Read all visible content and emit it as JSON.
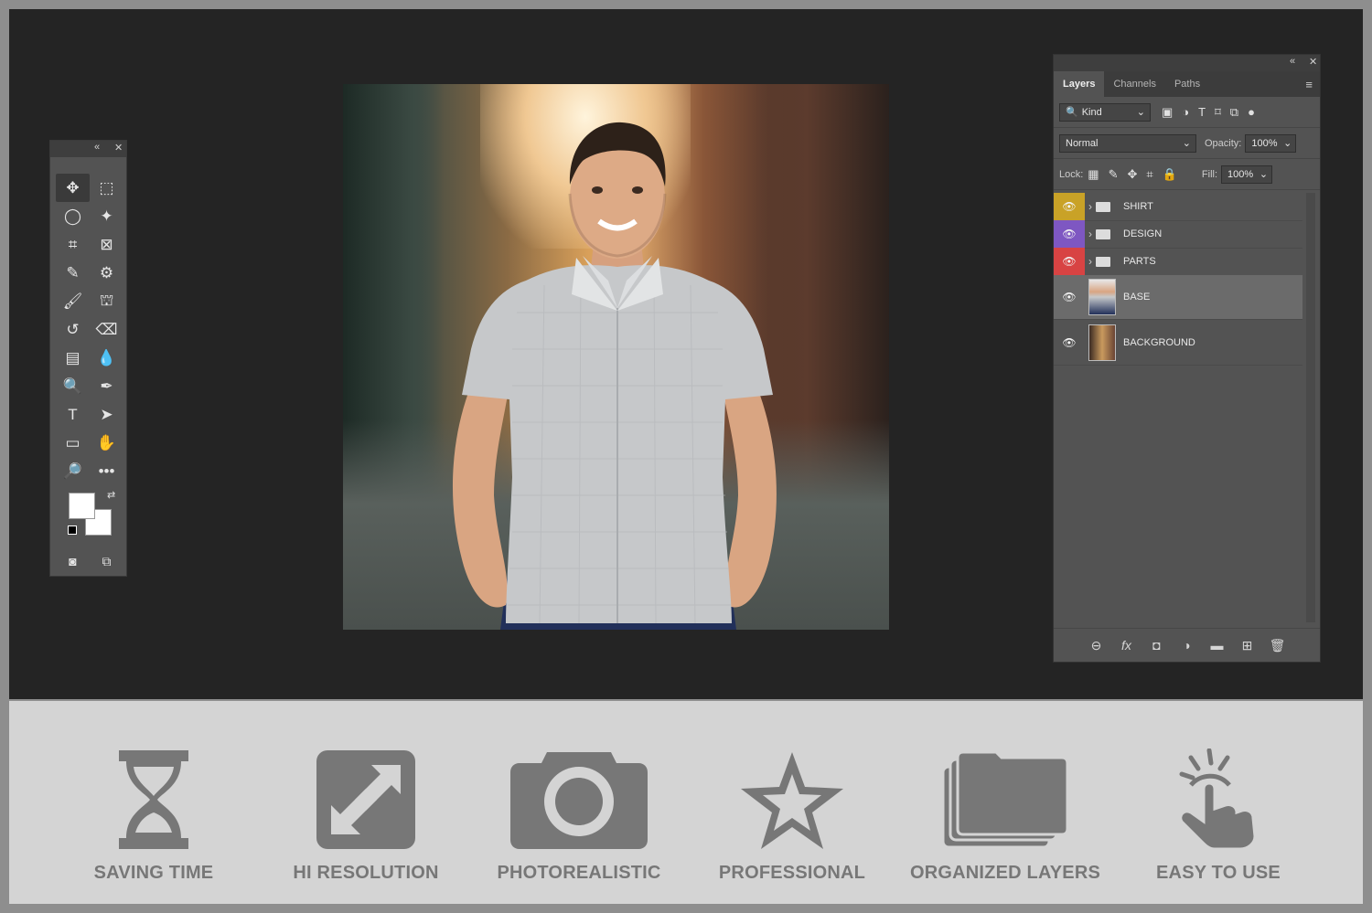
{
  "toolbox": {
    "collapse_icon": "double-chevron-left",
    "close_icon": "close",
    "tools": [
      {
        "name": "move-tool",
        "glyph": "✥"
      },
      {
        "name": "marquee-tool",
        "glyph": "⬚"
      },
      {
        "name": "lasso-tool",
        "glyph": "◯"
      },
      {
        "name": "magic-wand-tool",
        "glyph": "✦"
      },
      {
        "name": "crop-tool",
        "glyph": "⌗"
      },
      {
        "name": "frame-tool",
        "glyph": "⊠"
      },
      {
        "name": "eyedropper-tool",
        "glyph": "✎"
      },
      {
        "name": "spot-healing-tool",
        "glyph": "⚙"
      },
      {
        "name": "brush-tool",
        "glyph": "🖌"
      },
      {
        "name": "clone-stamp-tool",
        "glyph": "⛫"
      },
      {
        "name": "history-brush-tool",
        "glyph": "↺"
      },
      {
        "name": "eraser-tool",
        "glyph": "⌫"
      },
      {
        "name": "gradient-tool",
        "glyph": "▤"
      },
      {
        "name": "blur-tool",
        "glyph": "💧"
      },
      {
        "name": "dodge-tool",
        "glyph": "🔍"
      },
      {
        "name": "pen-tool",
        "glyph": "✒"
      },
      {
        "name": "type-tool",
        "glyph": "T"
      },
      {
        "name": "path-selection-tool",
        "glyph": "➤"
      },
      {
        "name": "rectangle-tool",
        "glyph": "▭"
      },
      {
        "name": "hand-tool",
        "glyph": "✋"
      },
      {
        "name": "zoom-tool",
        "glyph": "🔎"
      },
      {
        "name": "more-tools",
        "glyph": "•••"
      }
    ],
    "swap_icon": "⇄"
  },
  "layers_panel": {
    "tabs": [
      "Layers",
      "Channels",
      "Paths"
    ],
    "filter": {
      "label": "Kind"
    },
    "blend_mode": "Normal",
    "opacity_label": "Opacity:",
    "opacity_value": "100%",
    "lock_label": "Lock:",
    "fill_label": "Fill:",
    "fill_value": "100%",
    "layers": [
      {
        "name": "SHIRT",
        "type": "group",
        "eye_color": "#c9a227"
      },
      {
        "name": "DESIGN",
        "type": "group",
        "eye_color": "#7e57c2"
      },
      {
        "name": "PARTS",
        "type": "group",
        "eye_color": "#d84343"
      },
      {
        "name": "BASE",
        "type": "layer",
        "selected": true
      },
      {
        "name": "BACKGROUND",
        "type": "layer"
      }
    ]
  },
  "features": [
    {
      "label": "SAVING TIME",
      "icon": "hourglass-icon"
    },
    {
      "label": "HI RESOLUTION",
      "icon": "expand-arrows-icon"
    },
    {
      "label": "PHOTOREALISTIC",
      "icon": "camera-icon"
    },
    {
      "label": "PROFESSIONAL",
      "icon": "star-icon"
    },
    {
      "label": "ORGANIZED LAYERS",
      "icon": "stacked-folders-icon"
    },
    {
      "label": "EASY TO USE",
      "icon": "tap-hand-icon"
    }
  ]
}
